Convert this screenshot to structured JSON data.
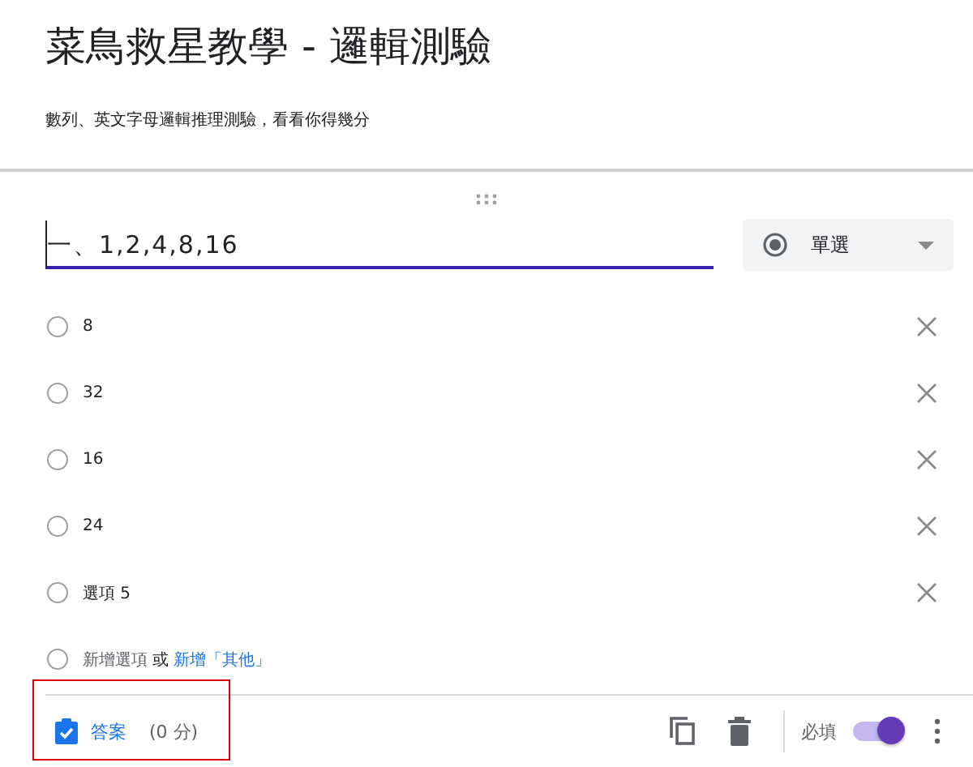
{
  "form": {
    "title": "菜鳥救星教學 - 邏輯測驗",
    "description": "數列、英文字母邏輯推理測驗，看看你得幾分"
  },
  "question": {
    "text": "一、1,2,4,8,16",
    "type": {
      "label": "單選"
    },
    "options": [
      {
        "label": "8",
        "selected": false
      },
      {
        "label": "32",
        "selected": false
      },
      {
        "label": "16",
        "selected": false
      },
      {
        "label": "24",
        "selected": false
      },
      {
        "label": "選項 5",
        "selected": false
      }
    ],
    "add_option": {
      "label": "新增選項",
      "selected": false,
      "separator": "或",
      "link": "新增「其他」"
    },
    "footer": {
      "answer_key": "答案",
      "points": "(0 分)",
      "required_label": "必填",
      "required": true,
      "highlighted": true
    }
  }
}
